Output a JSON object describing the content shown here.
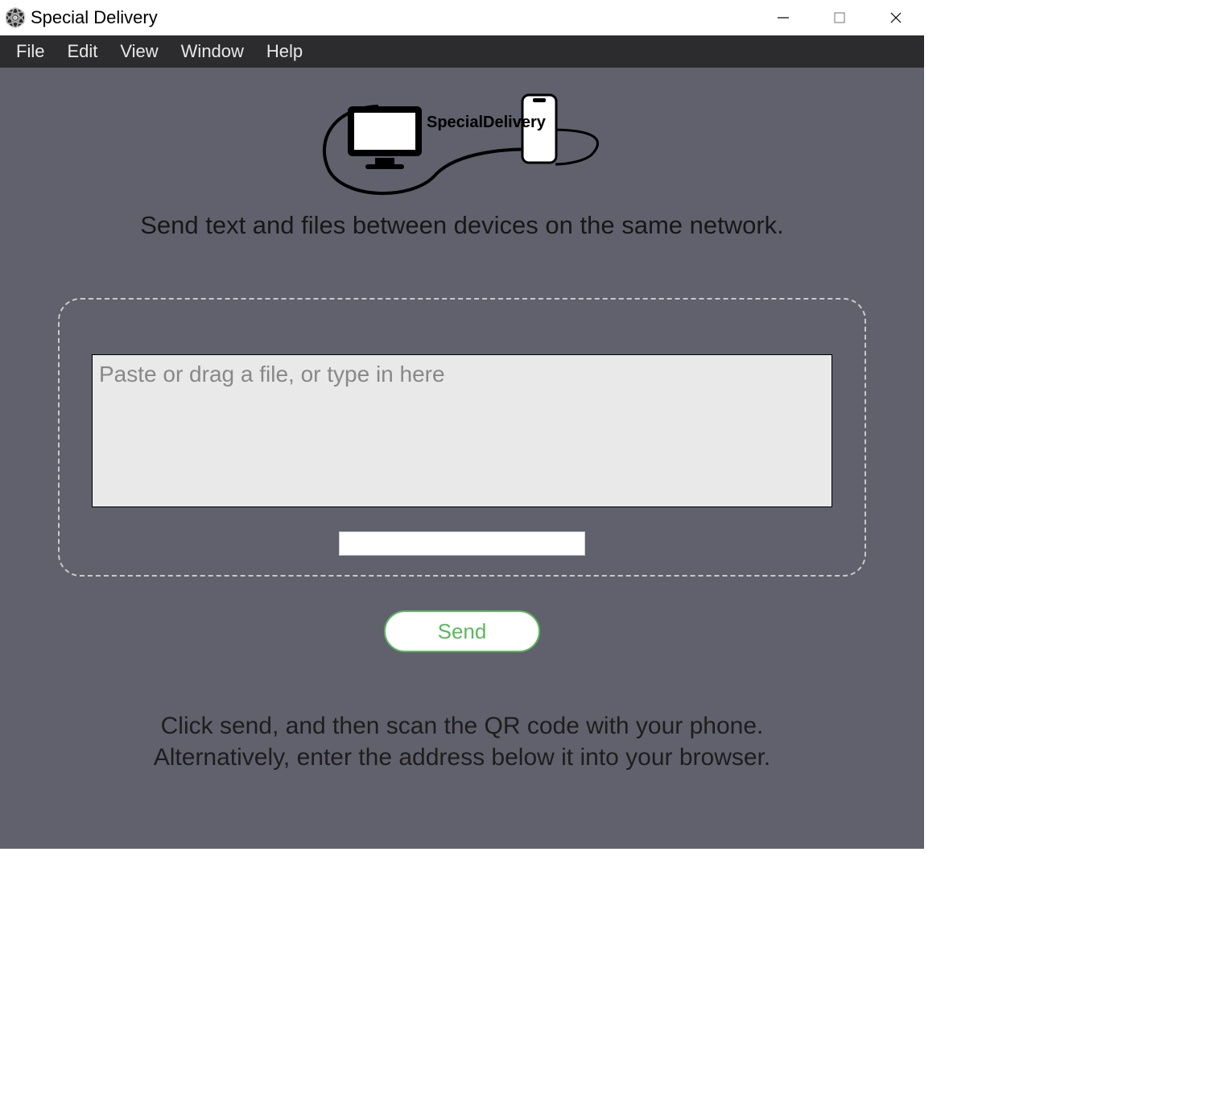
{
  "window": {
    "title": "Special Delivery"
  },
  "menu": {
    "file": "File",
    "edit": "Edit",
    "view": "View",
    "window": "Window",
    "help": "Help"
  },
  "logo": {
    "brand_text": "SpecialDelivery"
  },
  "tagline": "Send text and files between devices on the same network.",
  "input": {
    "placeholder": "Paste or drag a file, or type in here",
    "value": ""
  },
  "password": {
    "value": ""
  },
  "send_button": "Send",
  "instructions_line1": "Click send, and then scan the QR code with your phone.",
  "instructions_line2": "Alternatively, enter the address below it into your browser."
}
